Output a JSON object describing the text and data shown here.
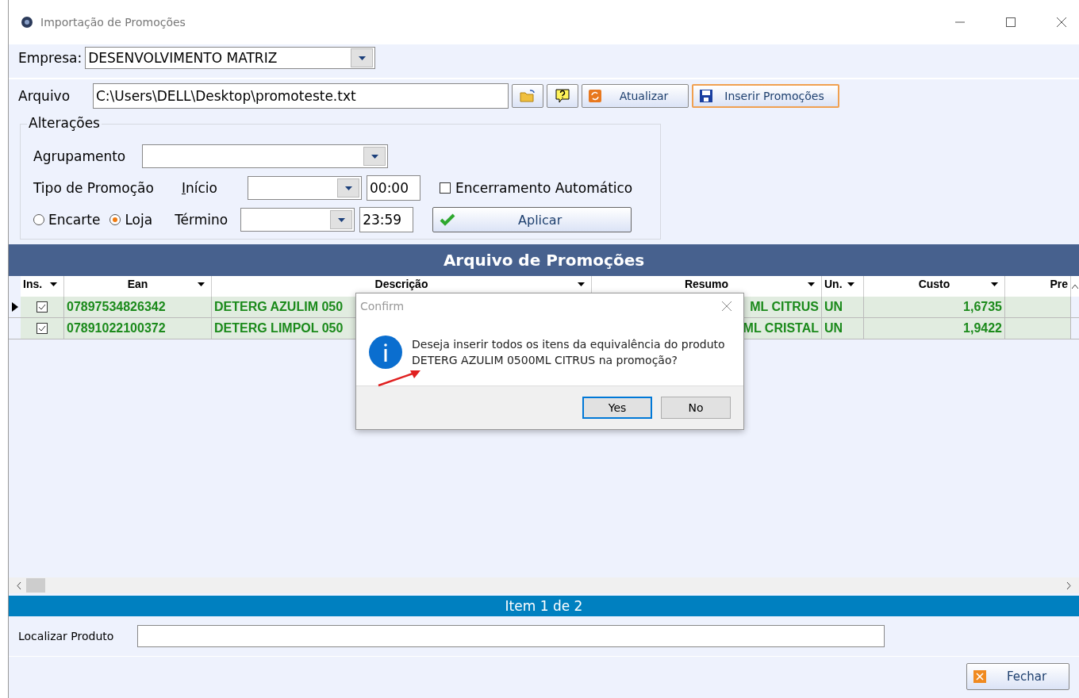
{
  "window": {
    "title": "Importação de Promoções"
  },
  "empresa": {
    "label": "Empresa:",
    "value": "DESENVOLVIMENTO MATRIZ"
  },
  "arquivo": {
    "label": "Arquivo",
    "value": "C:\\Users\\DELL\\Desktop\\promoteste.txt"
  },
  "toolbar": [
    {
      "kind": "folder"
    },
    {
      "kind": "help"
    },
    {
      "kind": "refresh",
      "label": "Atualizar",
      "focused": false
    },
    {
      "kind": "save",
      "label": "Inserir Promoções",
      "focused": true
    }
  ],
  "alteracoes": {
    "title": "Alterações",
    "agrupamento_label": "Agrupamento",
    "tipo_label": "Tipo de Promoção",
    "tipo_options": [
      {
        "label": "Encarte",
        "selected": false
      },
      {
        "label": "Loja",
        "selected": true
      }
    ],
    "inicio_label": "Início",
    "inicio_time": "00:00",
    "termino_label": "Término",
    "termino_time": "23:59",
    "encerramento": {
      "label": "Encerramento Automático",
      "checked": false
    },
    "apply_button": "Aplicar"
  },
  "grid": {
    "title": "Arquivo de Promoções",
    "columns": [
      {
        "label": "Ins."
      },
      {
        "label": "Ean"
      },
      {
        "label": "Descrição"
      },
      {
        "label": "Resumo"
      },
      {
        "label": "Un."
      },
      {
        "label": "Custo"
      },
      {
        "label": "Pre"
      }
    ],
    "rows": [
      {
        "selected": true,
        "checked": true,
        "ean": "07897534826342",
        "descricao": "DETERG AZULIM 050",
        "resumo": "ML CITRUS",
        "un": "UN",
        "custo": "1,6735"
      },
      {
        "selected": false,
        "checked": true,
        "ean": "07891022100372",
        "descricao": "DETERG LIMPOL 050",
        "resumo": "ML CRISTAL",
        "un": "UN",
        "custo": "1,9422"
      }
    ]
  },
  "status_bar": "Item 1 de 2",
  "localizar": {
    "label": "Localizar Produto"
  },
  "close_button": "Fechar",
  "dialog": {
    "title": "Confirm",
    "message_lines": [
      "Deseja inserir todos os itens da equivalência do produto",
      "DETERG AZULIM 0500ML CITRUS na promoção?"
    ],
    "buttons": [
      {
        "label": "Yes",
        "default": true
      },
      {
        "label": "No",
        "default": false
      }
    ]
  }
}
